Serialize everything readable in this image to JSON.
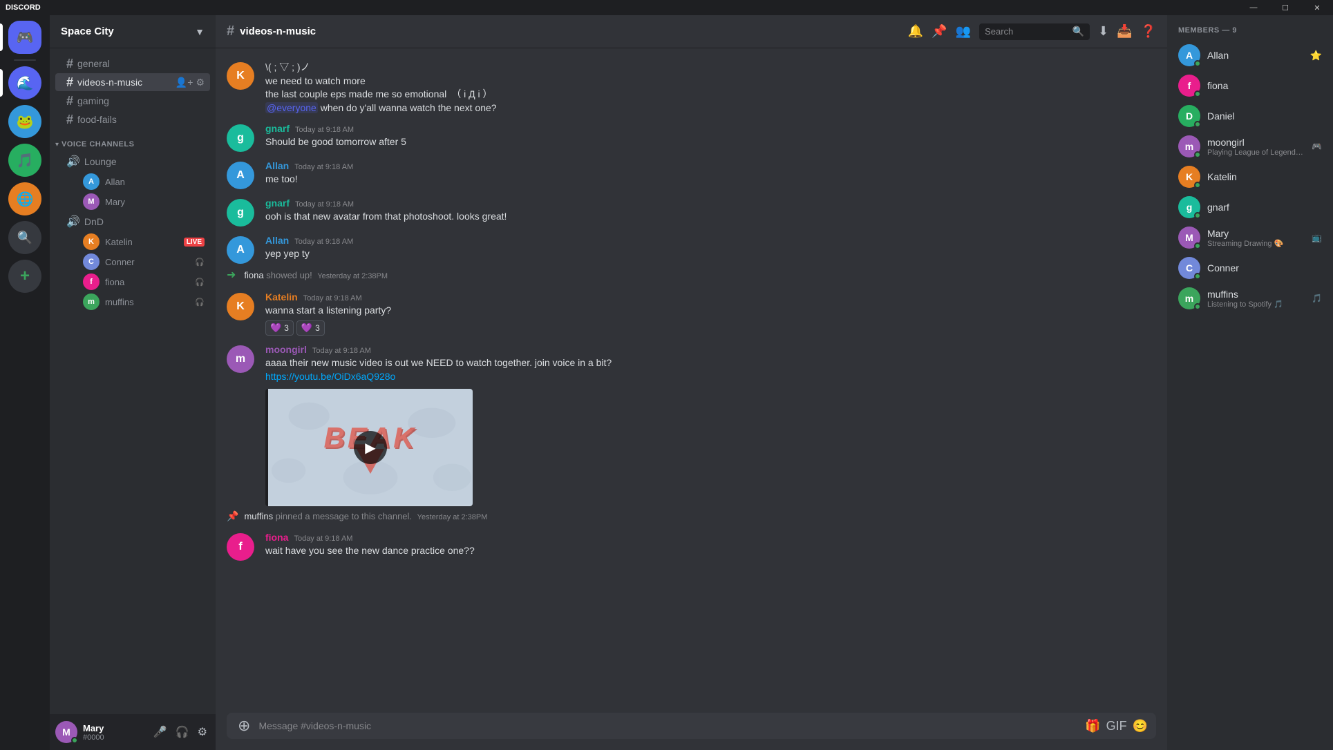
{
  "titlebar": {
    "logo": "DISCORD",
    "minimize": "—",
    "maximize": "☐",
    "close": "✕"
  },
  "servers": [
    {
      "id": "discord",
      "icon": "🎮",
      "label": "Discord Home",
      "color": "#5865f2"
    },
    {
      "id": "s1",
      "icon": "🌊",
      "label": "Server 1",
      "color": "#5865f2"
    },
    {
      "id": "s2",
      "icon": "🐸",
      "label": "Server 2",
      "color": "#27ae60"
    },
    {
      "id": "s3",
      "icon": "🎵",
      "label": "Server 3",
      "color": "#e67e22"
    },
    {
      "id": "s4",
      "icon": "🌐",
      "label": "Server 4",
      "color": "#3498db"
    },
    {
      "id": "search",
      "icon": "🔍",
      "label": "Explore",
      "color": "#36393f"
    },
    {
      "id": "add",
      "icon": "+",
      "label": "Add Server",
      "color": "#36393f"
    }
  ],
  "sidebar": {
    "server_name": "Space City",
    "channels": [
      {
        "name": "general",
        "type": "text"
      },
      {
        "name": "videos-n-music",
        "type": "text",
        "active": true
      },
      {
        "name": "gaming",
        "type": "text"
      },
      {
        "name": "food-fails",
        "type": "text"
      }
    ],
    "voice_channels": [
      {
        "name": "Lounge",
        "members": [
          {
            "name": "Allan",
            "icon": ""
          },
          {
            "name": "Mary",
            "icon": ""
          }
        ]
      },
      {
        "name": "DnD",
        "members": [
          {
            "name": "Katelin",
            "live": true
          },
          {
            "name": "Conner",
            "icon": "headphone"
          },
          {
            "name": "fiona",
            "icon": "headphone"
          },
          {
            "name": "muffins",
            "icon": "headphone"
          }
        ]
      }
    ]
  },
  "current_user": {
    "name": "Mary",
    "tag": "#0000",
    "avatar_color": "#9b59b6"
  },
  "channel": {
    "name": "videos-n-music",
    "search_placeholder": "Search"
  },
  "messages": [
    {
      "id": "m1",
      "author": "Katelin",
      "author_color": "#e67e22",
      "avatar_color": "#e67e22",
      "timestamp": "",
      "lines": [
        "\\( ; ▽ ; )ノ",
        "we need to watch more",
        "the last couple eps made me so emotional　（ i Д i ）",
        "@everyone when do y'all wanna watch the next one?"
      ],
      "has_mention": true
    },
    {
      "id": "m2",
      "author": "gnarf",
      "author_color": "#1abc9c",
      "avatar_color": "#1abc9c",
      "timestamp": "Today at 9:18 AM",
      "lines": [
        "Should be good tomorrow after 5"
      ]
    },
    {
      "id": "m3",
      "author": "Allan",
      "author_color": "#3498db",
      "avatar_color": "#3498db",
      "timestamp": "Today at 9:18 AM",
      "lines": [
        "me too!"
      ]
    },
    {
      "id": "m4",
      "author": "gnarf",
      "author_color": "#1abc9c",
      "avatar_color": "#1abc9c",
      "timestamp": "Today at 9:18 AM",
      "lines": [
        "ooh is that new avatar from that photoshoot. looks great!"
      ]
    },
    {
      "id": "m5",
      "author": "Allan",
      "author_color": "#3498db",
      "avatar_color": "#3498db",
      "timestamp": "Today at 9:18 AM",
      "lines": [
        "yep yep ty"
      ]
    },
    {
      "id": "m6",
      "type": "join",
      "text": "fiona showed up!",
      "timestamp": "Yesterday at 2:38PM"
    },
    {
      "id": "m7",
      "author": "Katelin",
      "author_color": "#e67e22",
      "avatar_color": "#e67e22",
      "timestamp": "Today at 9:18 AM",
      "lines": [
        "wanna start a listening party?"
      ],
      "reactions": [
        {
          "emoji": "💜",
          "count": 3
        },
        {
          "emoji": "💜",
          "count": 3
        }
      ]
    },
    {
      "id": "m8",
      "author": "moongirl",
      "author_color": "#9b59b6",
      "avatar_color": "#9b59b6",
      "timestamp": "Today at 9:18 AM",
      "lines": [
        "aaaa their new music video is out we NEED to watch together. join voice in a bit?"
      ],
      "link": "https://youtu.be/OiDx6aQ928o",
      "has_embed": true
    },
    {
      "id": "m9",
      "type": "pin",
      "user": "muffins",
      "text": "pinned a message to this channel.",
      "timestamp": "Yesterday at 2:38PM"
    },
    {
      "id": "m10",
      "author": "fiona",
      "author_color": "#e91e8c",
      "avatar_color": "#e91e8c",
      "timestamp": "Today at 9:18 AM",
      "lines": [
        "wait have you see the new dance practice one??"
      ]
    }
  ],
  "members": {
    "header": "MEMBERS — 9",
    "list": [
      {
        "name": "Allan",
        "color": "#3498db",
        "status": "online",
        "badge": "⭐",
        "activity": ""
      },
      {
        "name": "fiona",
        "color": "#e91e8c",
        "status": "online",
        "activity": ""
      },
      {
        "name": "Daniel",
        "color": "#27ae60",
        "status": "online",
        "activity": ""
      },
      {
        "name": "moongirl",
        "color": "#9b59b6",
        "status": "online",
        "activity": "Playing League of Legends",
        "icon": "🎮"
      },
      {
        "name": "Katelin",
        "color": "#e67e22",
        "status": "online",
        "activity": ""
      },
      {
        "name": "gnarf",
        "color": "#1abc9c",
        "status": "online",
        "activity": ""
      },
      {
        "name": "Mary",
        "color": "#9b59b6",
        "status": "online",
        "activity": "Streaming Drawing 🎨",
        "icon": "📺"
      },
      {
        "name": "Conner",
        "color": "#7289da",
        "status": "online",
        "activity": ""
      },
      {
        "name": "muffins",
        "color": "#3ba55c",
        "status": "online",
        "activity": "Listening to Spotify",
        "icon": "🎵"
      }
    ]
  },
  "input": {
    "placeholder": "Message #videos-n-music"
  }
}
